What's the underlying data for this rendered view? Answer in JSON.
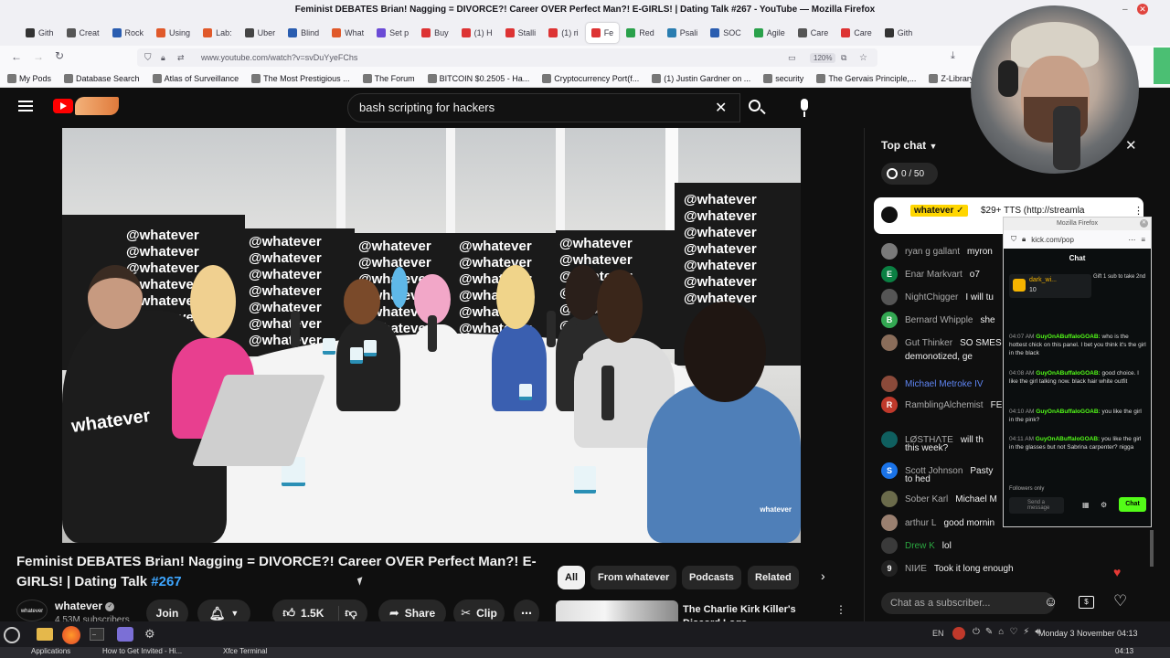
{
  "window": {
    "title": "Feminist DEBATES Brian! Nagging = DIVORCE?! Career OVER Perfect Man?! E-GIRLS! | Dating Talk #267 - YouTube — Mozilla Firefox"
  },
  "tabs": [
    {
      "label": "Gith",
      "color": "#333"
    },
    {
      "label": "Creat",
      "color": "#555"
    },
    {
      "label": "Rock",
      "color": "#2a5db0"
    },
    {
      "label": "Using",
      "color": "#e0592a"
    },
    {
      "label": "Lab:",
      "color": "#e0592a"
    },
    {
      "label": "Uber",
      "color": "#444"
    },
    {
      "label": "Blind",
      "color": "#2a5db0"
    },
    {
      "label": "What",
      "color": "#e0592a"
    },
    {
      "label": "Set p",
      "color": "#6b4bd6"
    },
    {
      "label": "Buy",
      "color": "#d33"
    },
    {
      "label": "(1) H",
      "color": "#d33"
    },
    {
      "label": "Stalli",
      "color": "#d33"
    },
    {
      "label": "(1) ri",
      "color": "#d33"
    },
    {
      "label": "Fe",
      "color": "#d33"
    },
    {
      "label": "Red",
      "color": "#2aa14b"
    },
    {
      "label": "Psali",
      "color": "#2a7db0"
    },
    {
      "label": "SOC",
      "color": "#2a5db0"
    },
    {
      "label": "Agile",
      "color": "#2aa14b"
    },
    {
      "label": "Care",
      "color": "#555"
    },
    {
      "label": "Care",
      "color": "#d33"
    },
    {
      "label": "Gith",
      "color": "#333"
    }
  ],
  "nav": {
    "url": "www.youtube.com/watch?v=svDuYyeFChs",
    "zoom": "120%"
  },
  "bookmarks": [
    "My Pods",
    "Database Search",
    "Atlas of Surveillance",
    "The Most Prestigious ...",
    "The Forum",
    "BITCOIN $0.2505 - Ha...",
    "Cryptocurrency Port(f...",
    "(1) Justin Gardner on ...",
    "security",
    "The Gervais Principle,...",
    "Z-Library – the world's ..."
  ],
  "youtube": {
    "search_value": "bash scripting for hackers",
    "brand_color": "#ff0000"
  },
  "video": {
    "watermark": "whatever",
    "panel_text": "@whatever",
    "hoodie_text": "whatever",
    "title": "Feminist DEBATES Brian! Nagging = DIVORCE?! Career OVER Perfect Man?! E-GIRLS! | Dating Talk",
    "title_tag": "#267",
    "channel_name": "whatever",
    "channel_avatar_text": "whatever",
    "subscribers": "4.53M subscribers",
    "join_label": "Join",
    "likes": "1.5K",
    "share_label": "Share",
    "clip_label": "Clip"
  },
  "chips": [
    "All",
    "From whatever",
    "Podcasts",
    "Related"
  ],
  "recommended": {
    "title": "The Charlie Kirk Killer's Discord Logs"
  },
  "chat": {
    "header": "Top chat",
    "counter": "0 / 50",
    "pinned_user": "whatever",
    "pinned_msg": "$29+ TTS (http://streamla",
    "input_placeholder": "Chat as a subscriber...",
    "messages": [
      {
        "user": "ryan g gallant",
        "msg": "myron",
        "color": "#7a7a7a",
        "initial": ""
      },
      {
        "user": "Enar Markvart",
        "msg": "o7",
        "color": "#0b8043",
        "initial": "E"
      },
      {
        "user": "NightChigger",
        "msg": "I will tu",
        "color": "#555",
        "initial": ""
      },
      {
        "user": "Bernard Whipple",
        "msg": "she",
        "color": "#33a852",
        "initial": "B"
      },
      {
        "user": "Gut Thinker",
        "msg": "SO SMES",
        "color": "#8a6d5a",
        "initial": ""
      },
      {
        "user": "",
        "msg": "demonotized, ge",
        "color": "",
        "initial": ""
      },
      {
        "user": "Michael Metroke IV",
        "msg": "",
        "color": "#8b4a3a",
        "initial": ""
      },
      {
        "user": "RamblingAlchemist",
        "msg": "FELONICITY CHRIST I",
        "color": "#c0392b",
        "initial": "R"
      },
      {
        "user": "LØSTHΛTE",
        "msg": "will th",
        "color": "#0f5f5f",
        "initial": ""
      },
      {
        "user": "",
        "msg": "this week?",
        "color": "",
        "initial": ""
      },
      {
        "user": "Scott Johnson",
        "msg": "Pasty",
        "color": "#1a73e8",
        "initial": "S"
      },
      {
        "user": "",
        "msg": "to hed",
        "color": "",
        "initial": ""
      },
      {
        "user": "Sober Karl",
        "msg": "Michael M",
        "color": "#6b6b4b",
        "initial": ""
      },
      {
        "user": "arthur L",
        "msg": "good mornin",
        "color": "#9a8070",
        "initial": ""
      },
      {
        "user": "Drew K",
        "msg": "lol",
        "color": "#3a3a3a",
        "initial": ""
      },
      {
        "user": "NIИE",
        "msg": "Took it long enough",
        "color": "#222",
        "initial": "9"
      }
    ]
  },
  "kick": {
    "window_title": "Mozilla Firefox",
    "url": "kick.com/pop",
    "tab": "Chat",
    "gift_user": "dark_wi...",
    "gift_count": "10",
    "gift_text": "Gift 1 sub to take 2nd",
    "messages": [
      {
        "time": "04:07 AM",
        "user": "GuyOnABuffaloGOAB:",
        "text": "who is the hottest chick on this panel. I bet you think it's the girl in the black"
      },
      {
        "time": "04:08 AM",
        "user": "GuyOnABuffaloGOAB:",
        "text": "good choice. I like the girl talking now. black hair white outfit"
      },
      {
        "time": "04:10 AM",
        "user": "GuyOnABuffaloGOAB:",
        "text": "you like the girl in the pink?"
      },
      {
        "time": "04:11 AM",
        "user": "GuyOnABuffaloGOAB:",
        "text": "you like the girl in the glasses but not Sabrina carpenter? nigga"
      }
    ],
    "followers_only": "Followers only",
    "send_placeholder": "Send a message",
    "chat_button": "Chat",
    "accent": "#53fc18"
  },
  "system": {
    "lang": "EN",
    "clock": "Monday 3 November 04:13",
    "small_clock": "04:13",
    "window_items": [
      "Applications",
      "How to Get Invited - Hi...",
      "Xfce Terminal"
    ]
  }
}
